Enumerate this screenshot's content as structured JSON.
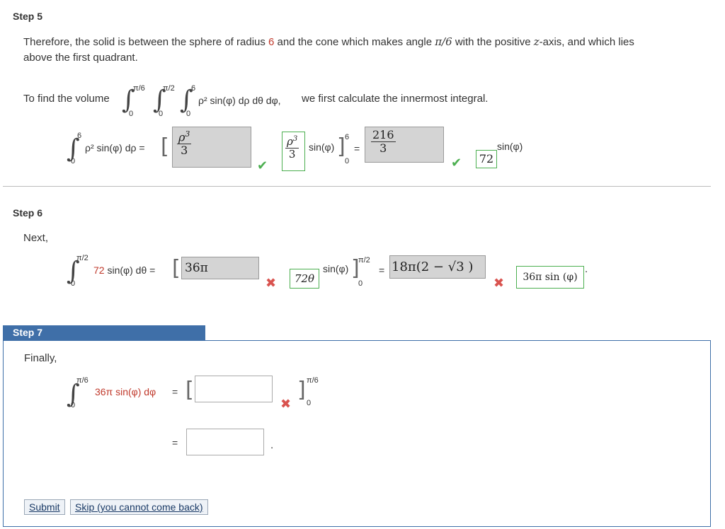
{
  "step5": {
    "heading": "Step 5",
    "para1_a": "Therefore, the solid is between the sphere of radius ",
    "radius": "6",
    "para1_b": " and the cone which makes angle ",
    "angle": "π/6",
    "para1_c": " with the positive ",
    "zaxis": "z",
    "para1_d": "-axis, and which lies",
    "para1_line2": "above the first quadrant.",
    "volume_prefix": "To find the volume",
    "limit_pi6": "π/6",
    "limit_pi2": "π/2",
    "limit_6": "6",
    "limit_0": "0",
    "integrand": "ρ² sin(φ) dρ dθ dφ,",
    "volume_suffix": "we first calculate the innermost integral.",
    "inner_integrand": "ρ² sin(φ) dρ =",
    "box1_num": "ρ3",
    "box1_den": "3",
    "box2_num": "ρ3",
    "box2_den": "3",
    "sin_label": "sin(φ)",
    "eval_upper": "6",
    "eval_lower": "0",
    "equals": "=",
    "box3_num": "216",
    "box3_den": "3",
    "box4_value": "72",
    "box4_sin": "sin(φ)"
  },
  "step6": {
    "heading": "Step 6",
    "next": "Next,",
    "upper": "π/2",
    "lower": "0",
    "integrand_coef": "72",
    "integrand_rest": "sin(φ) dθ =",
    "box1_value": "36π",
    "box2_value": "72θ",
    "sin_label": "sin(φ)",
    "eval_upper": "π/2",
    "eval_lower": "0",
    "equals": "=",
    "box3_value": "18π(2 − √3 )",
    "box4_value": "36π sin (φ)",
    "period": "."
  },
  "step7": {
    "heading": "Step 7",
    "finally": "Finally,",
    "upper": "π/6",
    "lower": "0",
    "integrand": "36π sin(φ) dφ",
    "equals": "=",
    "eval_upper": "π/6",
    "eval_lower": "0",
    "input1_value": "",
    "input2_value": "",
    "period": "."
  },
  "buttons": {
    "submit": "Submit",
    "skip": "Skip (you cannot come back)"
  },
  "colors": {
    "accent_blue": "#3f6fa8",
    "correct_green": "#4caf50",
    "wrong_red": "#d9534f"
  }
}
